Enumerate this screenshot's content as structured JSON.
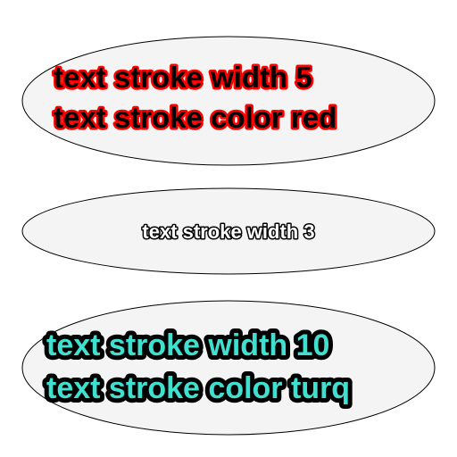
{
  "shapes": [
    {
      "lines": [
        "text stroke width 5",
        "text stroke color red"
      ],
      "fill_color": "#000000",
      "stroke_color": "#ff0000",
      "stroke_width": 5
    },
    {
      "lines": [
        "text stroke width 3"
      ],
      "fill_color": "#ffffff",
      "stroke_color": "#000000",
      "stroke_width": 3
    },
    {
      "lines": [
        "text stroke width 10",
        "text stroke color turq"
      ],
      "fill_color": "#40e0d0",
      "stroke_color": "#000000",
      "stroke_width": 10
    }
  ]
}
